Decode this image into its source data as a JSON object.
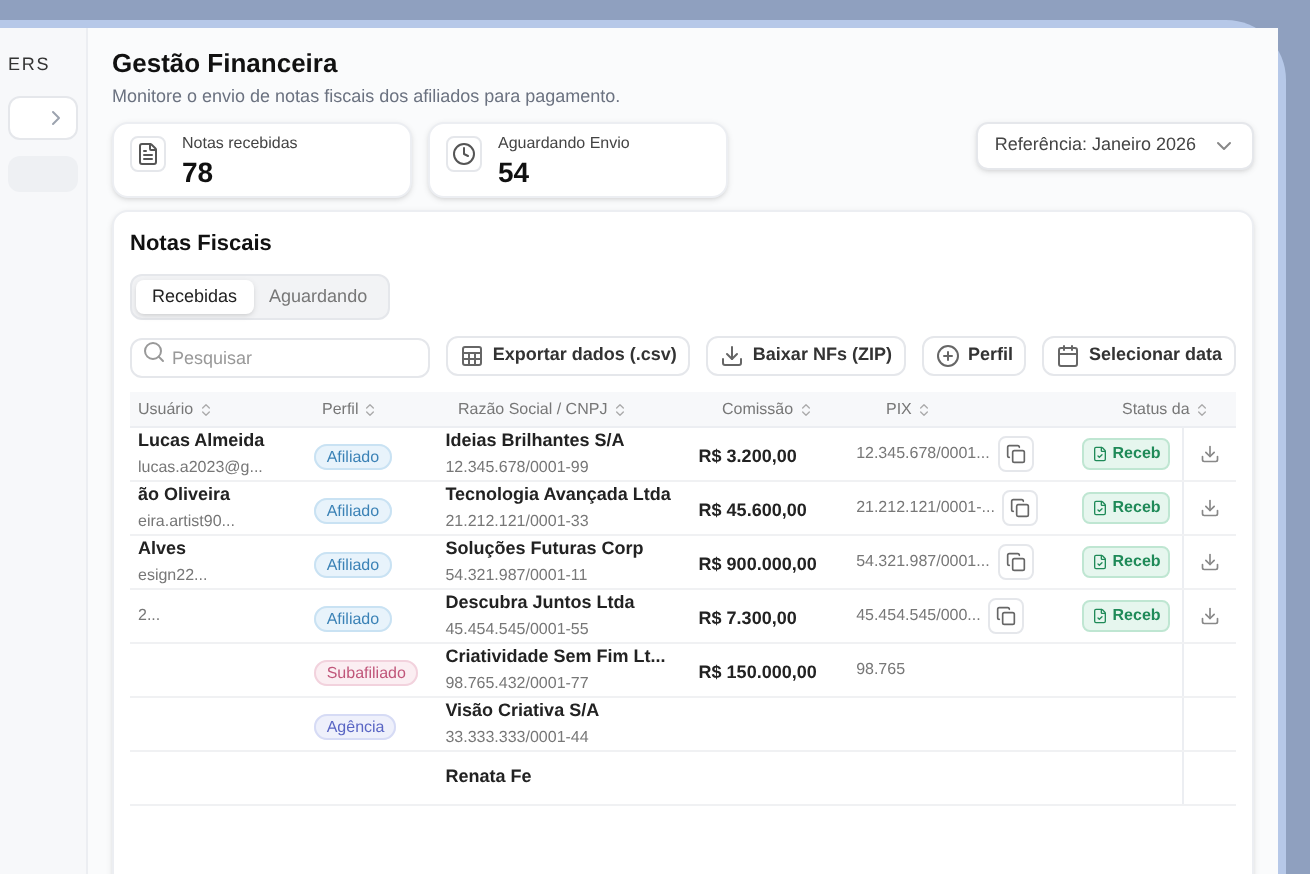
{
  "brand": "ERS",
  "header": {
    "title": "Gestão Financeira",
    "subtitle": "Monitore o envio de notas fiscais dos afiliados para pagamento."
  },
  "stats": [
    {
      "label": "Notas recebidas",
      "value": "78",
      "kind": "document"
    },
    {
      "label": "Aguardando Envio",
      "value": "54",
      "kind": "clock"
    }
  ],
  "reference": {
    "label": "Referência: Janeiro 2026"
  },
  "section": {
    "title": "Notas Fiscais",
    "tabs": [
      {
        "label": "Recebidas",
        "selected": true
      },
      {
        "label": "Aguardando",
        "selected": false
      }
    ],
    "search": {
      "placeholder": "Pesquisar"
    },
    "actions": [
      {
        "label": "Exportar dados (.csv)",
        "kind": "table"
      },
      {
        "label": "Baixar NFs (ZIP)",
        "kind": "download"
      },
      {
        "label": "Perfil",
        "kind": "plus"
      },
      {
        "label": "Selecionar data",
        "kind": "calendar"
      }
    ]
  },
  "table": {
    "columns": [
      "Usuário",
      "Perfil",
      "Razão Social / CNPJ",
      "Comissão",
      "PIX",
      "Status da"
    ],
    "rows": [
      {
        "name": "Lucas Almeida",
        "email": "lucas.a2023@g...",
        "profile": {
          "label": "Afiliado",
          "kind": "affiliate"
        },
        "company": "Ideias Brilhantes S/A",
        "cnpj": "12.345.678/0001-99",
        "commission": "R$ 3.200,00",
        "pix": "12.345.678/0001...",
        "status": {
          "label": "Receb",
          "kind": "received"
        }
      },
      {
        "name": "ão Oliveira",
        "email": "eira.artist90...",
        "profile": {
          "label": "Afiliado",
          "kind": "affiliate"
        },
        "company": "Tecnologia Avançada Ltda",
        "cnpj": "21.212.121/0001-33",
        "commission": "R$ 45.600,00",
        "pix": "21.212.121/0001-...",
        "status": {
          "label": "Receb",
          "kind": "received"
        }
      },
      {
        "name": "Alves",
        "email": "esign22...",
        "profile": {
          "label": "Afiliado",
          "kind": "affiliate"
        },
        "company": "Soluções Futuras Corp",
        "cnpj": "54.321.987/0001-11",
        "commission": "R$ 900.000,00",
        "pix": "54.321.987/0001...",
        "status": {
          "label": "Receb",
          "kind": "received"
        }
      },
      {
        "email": "2...",
        "profile": {
          "label": "Afiliado",
          "kind": "affiliate"
        },
        "company": "Descubra Juntos Ltda",
        "cnpj": "45.454.545/0001-55",
        "commission": "R$ 7.300,00",
        "pix": "45.454.545/000...",
        "status": {
          "label": "Receb",
          "kind": "received"
        }
      },
      {
        "profile": {
          "label": "Subafiliado",
          "kind": "subaffiliate"
        },
        "company": "Criatividade Sem Fim Lt...",
        "cnpj": "98.765.432/0001-77",
        "commission": "R$ 150.000,00",
        "pix": "98.765"
      },
      {
        "profile": {
          "label": "Agência",
          "kind": "agency"
        },
        "company": "Visão Criativa S/A",
        "cnpj": "33.333.333/0001-44"
      },
      {
        "company": "Renata Fe"
      }
    ]
  }
}
